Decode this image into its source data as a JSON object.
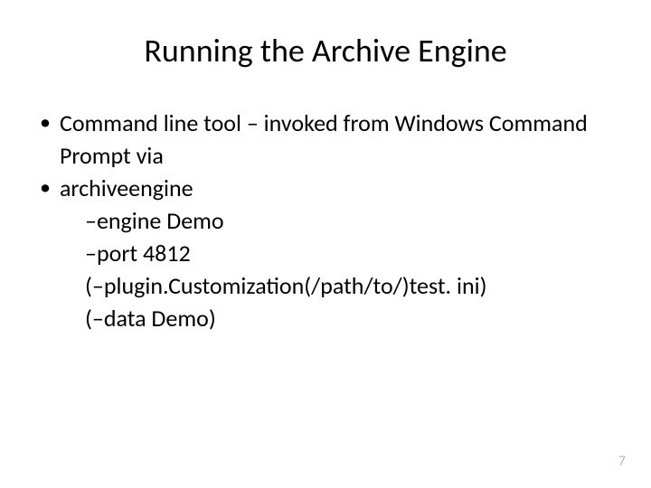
{
  "title": "Running the Archive Engine",
  "bullets": {
    "b1": "Command line tool – invoked from Windows Command Prompt via",
    "b2": "archiveengine"
  },
  "sublines": {
    "s1": "–engine Demo",
    "s2": "–port 4812",
    "s3": "(–plugin.Customization(/path/to/)test. ini)",
    "s4": "(–data Demo)"
  },
  "page_number": "7"
}
